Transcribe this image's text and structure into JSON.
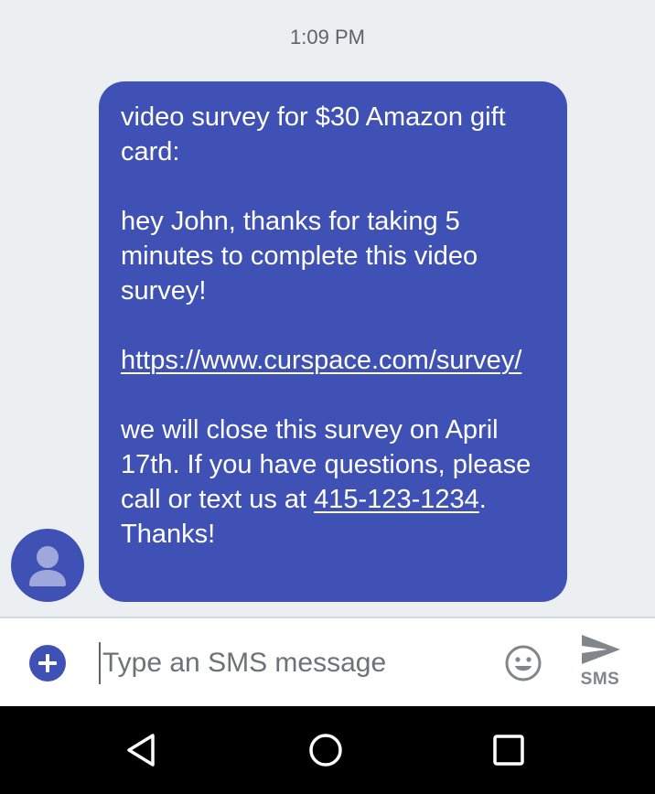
{
  "conversation": {
    "timestamp": "1:09 PM",
    "message": {
      "line1": "video survey for $30 Amazon gift card:",
      "line2": "hey John, thanks for taking 5 minutes to complete this video survey!",
      "link": "https://www.curspace.com/survey/",
      "line3_before": "we will close this survey on April 17th. If you have questions, please call or text us at ",
      "phone": "415-123-1234",
      "line3_after": ". Thanks!"
    },
    "avatar_icon": "person-icon"
  },
  "composer": {
    "add_icon": "plus-icon",
    "placeholder": "Type an SMS message",
    "emoji_icon": "emoji-icon",
    "send_icon": "send-icon",
    "send_label": "SMS"
  },
  "navbar": {
    "back_icon": "back-triangle-icon",
    "home_icon": "home-circle-icon",
    "recent_icon": "recent-apps-square-icon"
  },
  "colors": {
    "accent": "#3f51b5",
    "background": "#eceff1",
    "text_muted": "#5f6368",
    "navbar": "#000000"
  }
}
